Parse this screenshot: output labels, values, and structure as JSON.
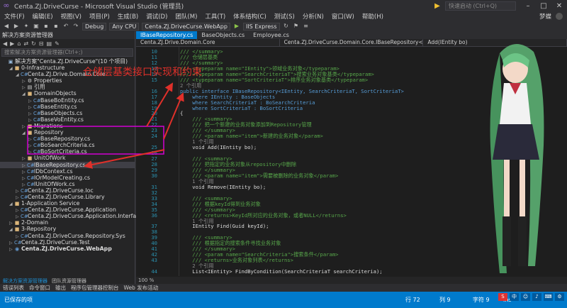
{
  "title": "Centa.ZJ.DriveCurse - Microsoft Visual Studio (管理员)",
  "quick_launch": "快速启动 (Ctrl+Q)",
  "menu": [
    "文件(F)",
    "编辑(E)",
    "视图(V)",
    "项目(P)",
    "生成(B)",
    "调试(D)",
    "团队(M)",
    "工具(T)",
    "体系结构(C)",
    "测试(S)",
    "分析(N)",
    "窗口(W)",
    "帮助(H)"
  ],
  "user": "梦蝶",
  "toolbar": {
    "config": "Debug",
    "platform": "Any CPU",
    "startup": "Centa.ZJ.DriveCurse.WebApp",
    "run": "IIS Express"
  },
  "solution_explorer": {
    "title": "解决方案资源管理器",
    "search_placeholder": "搜索解决方案资源管理器(Ctrl+;)",
    "items": [
      {
        "label": "解决方案\"Centa.ZJ.DriveCurse\"(10 个项目)",
        "indent": 0,
        "icon": "sln",
        "arrow": ""
      },
      {
        "label": "0-Infrastructure",
        "indent": 1,
        "icon": "folder",
        "arrow": "◢"
      },
      {
        "label": "Centa.ZJ.Drive.Domain.Core",
        "indent": 2,
        "icon": "csproj",
        "arrow": "◢"
      },
      {
        "label": "Properties",
        "indent": 3,
        "icon": "wrench",
        "arrow": "▷"
      },
      {
        "label": "引用",
        "indent": 3,
        "icon": "ref",
        "arrow": "▷"
      },
      {
        "label": "DomainObjects",
        "indent": 3,
        "icon": "folder",
        "arrow": "◢"
      },
      {
        "label": "BaseBoEntity.cs",
        "indent": 4,
        "icon": "cs",
        "arrow": "▷"
      },
      {
        "label": "BaseEntity.cs",
        "indent": 4,
        "icon": "cs",
        "arrow": "▷"
      },
      {
        "label": "BaseObjects.cs",
        "indent": 4,
        "icon": "cs",
        "arrow": "▷"
      },
      {
        "label": "BaseVoEntity.cs",
        "indent": 4,
        "icon": "cs",
        "arrow": "▷"
      },
      {
        "label": "Migrations",
        "indent": 3,
        "icon": "folder",
        "arrow": "▷"
      },
      {
        "label": "Repository",
        "indent": 3,
        "icon": "folder",
        "arrow": "◢"
      },
      {
        "label": "BaseRepository.cs",
        "indent": 4,
        "icon": "cs",
        "arrow": "▷"
      },
      {
        "label": "BoSearchCriteria.cs",
        "indent": 4,
        "icon": "cs",
        "arrow": "▷"
      },
      {
        "label": "BoSortCriteria.cs",
        "indent": 4,
        "icon": "cs",
        "arrow": "▷"
      },
      {
        "label": "UnitOfWork",
        "indent": 3,
        "icon": "folder",
        "arrow": "▷"
      },
      {
        "label": "IBaseRepository.cs",
        "indent": 3,
        "icon": "cs",
        "arrow": "▷",
        "selected": true
      },
      {
        "label": "IDbContext.cs",
        "indent": 3,
        "icon": "cs",
        "arrow": "▷"
      },
      {
        "label": "IOrModelCreating.cs",
        "indent": 3,
        "icon": "cs",
        "arrow": "▷"
      },
      {
        "label": "IUnitOfWork.cs",
        "indent": 3,
        "icon": "cs",
        "arrow": "▷"
      },
      {
        "label": "Centa.ZJ.DriveCurse.Ioc",
        "indent": 2,
        "icon": "csproj",
        "arrow": "▷"
      },
      {
        "label": "Centa.ZJ.DriveCurse.Library",
        "indent": 2,
        "icon": "csproj",
        "arrow": "▷"
      },
      {
        "label": "1-Application Service",
        "indent": 1,
        "icon": "folder",
        "arrow": "◢"
      },
      {
        "label": "Centa.ZJ.DriveCurse.Application",
        "indent": 2,
        "icon": "csproj",
        "arrow": "▷"
      },
      {
        "label": "Centa.ZJ.DriveCurse.Application.Interface",
        "indent": 2,
        "icon": "csproj",
        "arrow": "▷"
      },
      {
        "label": "2-Domain",
        "indent": 1,
        "icon": "folder",
        "arrow": "▷"
      },
      {
        "label": "3-Repository",
        "indent": 1,
        "icon": "folder",
        "arrow": "◢"
      },
      {
        "label": "Centa.ZJ.DriveCurse.Repository.Sys",
        "indent": 2,
        "icon": "csproj",
        "arrow": "▷"
      },
      {
        "label": "Centa.ZJ.DriveCurse.Test",
        "indent": 1,
        "icon": "csproj",
        "arrow": "▷"
      },
      {
        "label": "Centa.ZJ.DriveCurse.WebApp",
        "indent": 1,
        "icon": "web",
        "arrow": "▷",
        "bold": true
      }
    ],
    "bottom_tabs": [
      "解决方案资源管理器",
      "团队资源管理器"
    ]
  },
  "editor": {
    "tabs": [
      {
        "label": "IBaseRepository.cs",
        "active": true
      },
      {
        "label": "BaseObjects.cs",
        "active": false
      },
      {
        "label": "Employee.cs",
        "active": false
      }
    ],
    "nav": [
      "Centa.ZJ.Drive.Domain.Core",
      "Centa.ZJ.DriveCurse.Domain.Core.IBaseRepository<IEntity, Sea",
      "Add(IEntity bo)"
    ],
    "zoom": "100 %",
    "lines": [
      {
        "n": "10",
        "t": "/// </summary>",
        "c": "cm",
        "i": 0
      },
      {
        "n": "11",
        "t": "/// 仓储层基类",
        "c": "cm",
        "i": 0
      },
      {
        "n": "12",
        "t": "/// </summary>",
        "c": "cm",
        "i": 0
      },
      {
        "n": "13",
        "t": "/// <typeparam name=\"IEntity\">领域业务对象</typeparam>",
        "c": "cm",
        "i": 0
      },
      {
        "n": "14",
        "t": "/// <typeparam name=\"SearchCriteriaT\">搜索业务对象基类</typeparam>",
        "c": "cm",
        "i": 0
      },
      {
        "n": "15",
        "t": "/// <typeparam name=\"SortCriteriaT\">排序业务对象基类</typeparam>",
        "c": "cm",
        "i": 0
      },
      {
        "n": "",
        "t": "2 个引用",
        "c": "gr",
        "i": 0
      },
      {
        "n": "16",
        "t": "public interface IBaseRepository<IEntity, SearchCriteriaT, SortCriteriaT>",
        "c": "kw",
        "i": 0
      },
      {
        "n": "17",
        "t": "    where IEntity : BaseObjects",
        "c": "kw",
        "i": 0
      },
      {
        "n": "18",
        "t": "    where SearchCriteriaT : BoSearchCriteria",
        "c": "kw",
        "i": 0
      },
      {
        "n": "19",
        "t": "    where SortCriteriaT : BoSortCriteria",
        "c": "kw",
        "i": 0
      },
      {
        "n": "20",
        "t": "{",
        "c": "",
        "i": 0
      },
      {
        "n": "21",
        "t": "    /// <summary>",
        "c": "cm",
        "i": 0
      },
      {
        "n": "22",
        "t": "    /// 把一个新建的业务对象添加到Repository管理",
        "c": "cm",
        "i": 0
      },
      {
        "n": "23",
        "t": "    /// </summary>",
        "c": "cm",
        "i": 0
      },
      {
        "n": "24",
        "t": "    /// <param name=\"item\">新建的业务对象</param>",
        "c": "cm",
        "i": 0
      },
      {
        "n": "",
        "t": "    1 个引用",
        "c": "gr",
        "i": 0
      },
      {
        "n": "25",
        "t": "    void Add(IEntity bo);",
        "c": "",
        "i": 0
      },
      {
        "n": "26",
        "t": "",
        "c": "",
        "i": 0
      },
      {
        "n": "27",
        "t": "    /// <summary>",
        "c": "cm",
        "i": 0
      },
      {
        "n": "28",
        "t": "    /// 把指定的业务对象从repository中删除",
        "c": "cm",
        "i": 0
      },
      {
        "n": "29",
        "t": "    /// </summary>",
        "c": "cm",
        "i": 0
      },
      {
        "n": "30",
        "t": "    /// <param name=\"item\">需要被删除的业务对象</param>",
        "c": "cm",
        "i": 0
      },
      {
        "n": "",
        "t": "    1 个引用",
        "c": "gr",
        "i": 0
      },
      {
        "n": "31",
        "t": "    void Remove(IEntity bo);",
        "c": "",
        "i": 0
      },
      {
        "n": "32",
        "t": "",
        "c": "",
        "i": 0
      },
      {
        "n": "33",
        "t": "    /// <summary>",
        "c": "cm",
        "i": 0
      },
      {
        "n": "34",
        "t": "    /// 根据keyId得到业务对象",
        "c": "cm",
        "i": 0
      },
      {
        "n": "35",
        "t": "    /// </summary>",
        "c": "cm",
        "i": 0
      },
      {
        "n": "36",
        "t": "    /// <returns>KeyId所对应的业务对象，或者NULL</returns>",
        "c": "cm",
        "i": 0
      },
      {
        "n": "",
        "t": "    1 个引用",
        "c": "gr",
        "i": 0
      },
      {
        "n": "37",
        "t": "    IEntity Find(Guid keyId);",
        "c": "",
        "i": 0
      },
      {
        "n": "38",
        "t": "",
        "c": "",
        "i": 0
      },
      {
        "n": "39",
        "t": "    /// <summary>",
        "c": "cm",
        "i": 0
      },
      {
        "n": "40",
        "t": "    /// 根据指定的搜索条件寻找业务对象",
        "c": "cm",
        "i": 0
      },
      {
        "n": "41",
        "t": "    /// </summary>",
        "c": "cm",
        "i": 0
      },
      {
        "n": "42",
        "t": "    /// <param name=\"SearchCriteria\">搜索条件</param>",
        "c": "cm",
        "i": 0
      },
      {
        "n": "43",
        "t": "    /// <returns>业务对象列表</returns>",
        "c": "cm",
        "i": 0
      },
      {
        "n": "",
        "t": "    2 个引用",
        "c": "gr",
        "i": 0
      },
      {
        "n": "44",
        "t": "    List<IEntity> FindByCondition(SearchCriteriaT searchCriteria);",
        "c": "",
        "i": 0
      }
    ]
  },
  "output_tabs": [
    "错误列表",
    "命令窗口",
    "输出",
    "程序包管理器控制台",
    "Web 发布活动"
  ],
  "status": {
    "left": "已保存的项",
    "line": "行 72",
    "col": "列 9",
    "char": "字符 9",
    "mode": "Ins"
  },
  "annotation": "仓储层基类接口实现和约束",
  "colors": {
    "accent": "#007acc",
    "annotation": "#e0302a",
    "highlight": "#d200d2"
  }
}
